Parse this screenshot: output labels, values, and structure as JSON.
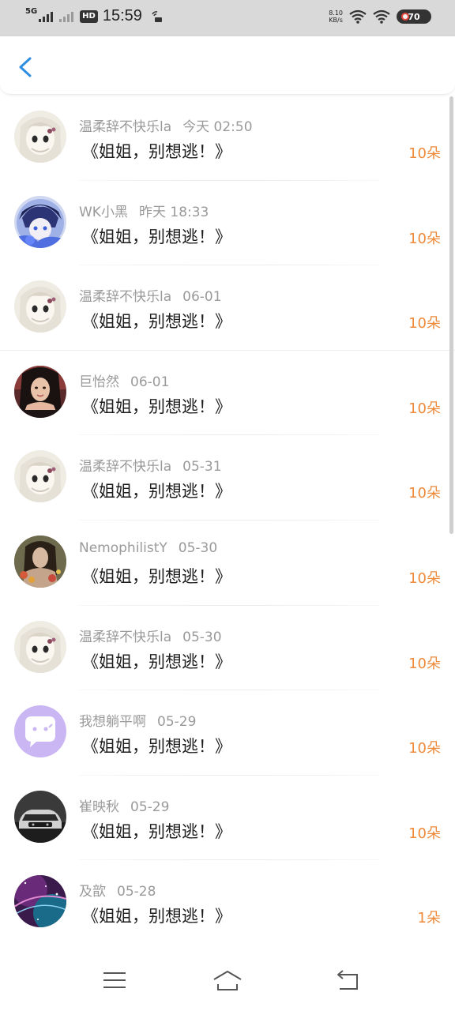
{
  "status_bar": {
    "network": "5G",
    "hd": "HD",
    "time": "15:59",
    "speed_value": "8.10",
    "speed_unit": "KB/s",
    "battery": "70"
  },
  "messages": [
    {
      "name": "温柔辞不快乐la",
      "date": "今天 02:50",
      "title": "《姐姐，别想逃！》",
      "gift": "10朵",
      "avatar": "anime-girl"
    },
    {
      "name": "WK小黑",
      "date": "昨天 18:33",
      "title": "《姐姐，别想逃！》",
      "gift": "10朵",
      "avatar": "anime-boy"
    },
    {
      "name": "温柔辞不快乐la",
      "date": "06-01",
      "title": "《姐姐，别想逃！》",
      "gift": "10朵",
      "avatar": "anime-girl"
    },
    {
      "name": "巨怡然",
      "date": "06-01",
      "title": "《姐姐，别想逃！》",
      "gift": "10朵",
      "avatar": "photo-girl"
    },
    {
      "name": "温柔辞不快乐la",
      "date": "05-31",
      "title": "《姐姐，别想逃！》",
      "gift": "10朵",
      "avatar": "anime-girl"
    },
    {
      "name": "NemophilistY",
      "date": "05-30",
      "title": "《姐姐，别想逃！》",
      "gift": "10朵",
      "avatar": "photo-woman"
    },
    {
      "name": "温柔辞不快乐la",
      "date": "05-30",
      "title": "《姐姐，别想逃！》",
      "gift": "10朵",
      "avatar": "anime-girl"
    },
    {
      "name": "我想躺平啊",
      "date": "05-29",
      "title": "《姐姐，别想逃！》",
      "gift": "10朵",
      "avatar": "purple-chat"
    },
    {
      "name": "崔映秋",
      "date": "05-29",
      "title": "《姐姐，别想逃！》",
      "gift": "10朵",
      "avatar": "car"
    },
    {
      "name": "及歆",
      "date": "05-28",
      "title": "《姐姐，别想逃！》",
      "gift": "1朵",
      "avatar": "galaxy"
    }
  ],
  "colors": {
    "accent_blue": "#2e8fe0",
    "gift_orange": "#ee8a3a",
    "meta_gray": "#9a9a9a"
  },
  "icons": {
    "back": "back-arrow-icon",
    "nav_menu": "menu-icon",
    "nav_home": "home-icon",
    "nav_back": "back-icon"
  }
}
